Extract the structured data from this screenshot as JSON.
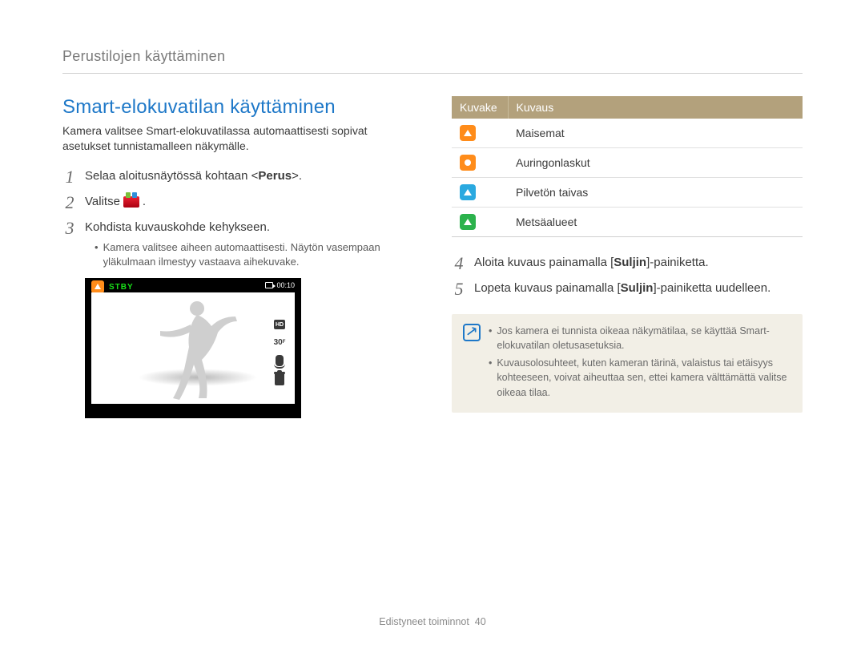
{
  "header": {
    "breadcrumb": "Perustilojen käyttäminen"
  },
  "section": {
    "title": "Smart-elokuvatilan käyttäminen",
    "intro": "Kamera valitsee Smart-elokuvatilassa automaattisesti sopivat asetukset tunnistamalleen näkymälle."
  },
  "steps_left": [
    {
      "n": "1",
      "pre": "Selaa aloitusnäytössä kohtaan <",
      "bold": "Perus",
      "post": ">."
    },
    {
      "n": "2",
      "pre": "Valitse ",
      "icon": "smart-mode-icon",
      "post": "."
    },
    {
      "n": "3",
      "pre": "Kohdista kuvauskohde kehykseen.",
      "sub": "Kamera valitsee aiheen automaattisesti. Näytön vasempaan yläkulmaan ilmestyy vastaava aihekuvake."
    }
  ],
  "camera": {
    "stby": "STBY",
    "time": "00:10",
    "hd": "HD",
    "fps": "30",
    "f_label": "F"
  },
  "table": {
    "head": {
      "icon": "Kuvake",
      "desc": "Kuvaus"
    },
    "rows": [
      {
        "icon": "landscape-orange",
        "label": "Maisemat"
      },
      {
        "icon": "sunset-orange",
        "label": "Auringonlaskut"
      },
      {
        "icon": "sky-cyan",
        "label": "Pilvetön taivas"
      },
      {
        "icon": "forest-green",
        "label": "Metsäalueet"
      }
    ]
  },
  "steps_right": [
    {
      "n": "4",
      "pre": "Aloita kuvaus painamalla [",
      "bold": "Suljin",
      "post": "]-painiketta."
    },
    {
      "n": "5",
      "pre": "Lopeta kuvaus painamalla [",
      "bold": "Suljin",
      "post": "]-painiketta uudelleen."
    }
  ],
  "info": {
    "items": [
      "Jos kamera ei tunnista oikeaa näkymätilaa, se käyttää Smart-elokuvatilan oletusasetuksia.",
      "Kuvausolosuhteet, kuten kameran tärinä, valaistus tai etäisyys kohteeseen, voivat aiheuttaa sen, ettei kamera välttämättä valitse oikeaa tilaa."
    ]
  },
  "footer": {
    "section": "Edistyneet toiminnot",
    "page": "40"
  }
}
